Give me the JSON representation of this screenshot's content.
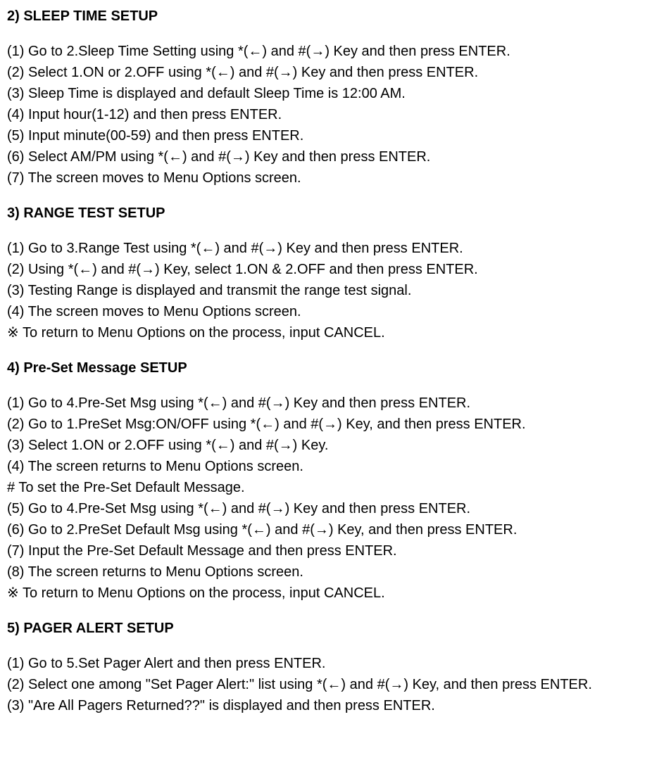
{
  "sections": [
    {
      "heading": "2) SLEEP TIME SETUP",
      "lines": [
        "(1) Go to 2.Sleep Time Setting using *(←) and #(→) Key and then press ENTER.",
        "(2) Select 1.ON or 2.OFF using *(←) and #(→) Key and then press ENTER.",
        "(3) Sleep Time is displayed and default Sleep Time is 12:00 AM.",
        "(4) Input hour(1-12) and then press ENTER.",
        "(5) Input minute(00-59) and then press ENTER.",
        "(6) Select AM/PM using *(←) and #(→) Key and then press ENTER.",
        "(7) The screen moves to Menu Options screen."
      ]
    },
    {
      "heading": "3) RANGE TEST SETUP",
      "lines": [
        "(1) Go to 3.Range Test using *(←) and #(→) Key and then press ENTER.",
        "(2) Using *(←) and #(→) Key, select 1.ON & 2.OFF and then press ENTER.",
        "(3) Testing Range is displayed and transmit the range test signal.",
        "(4) The screen moves to Menu Options screen.",
        "※ To return to Menu Options on the process, input CANCEL."
      ]
    },
    {
      "heading": "4) Pre-Set Message SETUP",
      "lines": [
        "(1) Go to 4.Pre-Set Msg using *(←) and #(→) Key and then press ENTER.",
        "(2) Go to 1.PreSet Msg:ON/OFF using *(←) and #(→) Key, and then press ENTER.",
        "(3) Select 1.ON or 2.OFF using *(←) and #(→) Key.",
        "(4) The screen returns to Menu Options screen.",
        " # To set the Pre-Set Default Message.",
        "(5) Go to 4.Pre-Set Msg using *(←) and #(→) Key and then press ENTER.",
        "(6) Go to 2.PreSet Default Msg using *(←) and #(→) Key, and then press ENTER.",
        "(7) Input the Pre-Set Default Message and then press ENTER.",
        "(8) The screen returns to Menu Options screen.",
        "※ To return to Menu Options on the process, input CANCEL."
      ]
    },
    {
      "heading": "5) PAGER ALERT SETUP",
      "lines": [
        "(1) Go to 5.Set Pager Alert and then press ENTER.",
        "(2) Select one among \"Set Pager Alert:\" list using *(←) and #(→) Key, and then press ENTER.",
        "(3) \"Are All Pagers Returned??\" is displayed and then press ENTER."
      ]
    }
  ]
}
